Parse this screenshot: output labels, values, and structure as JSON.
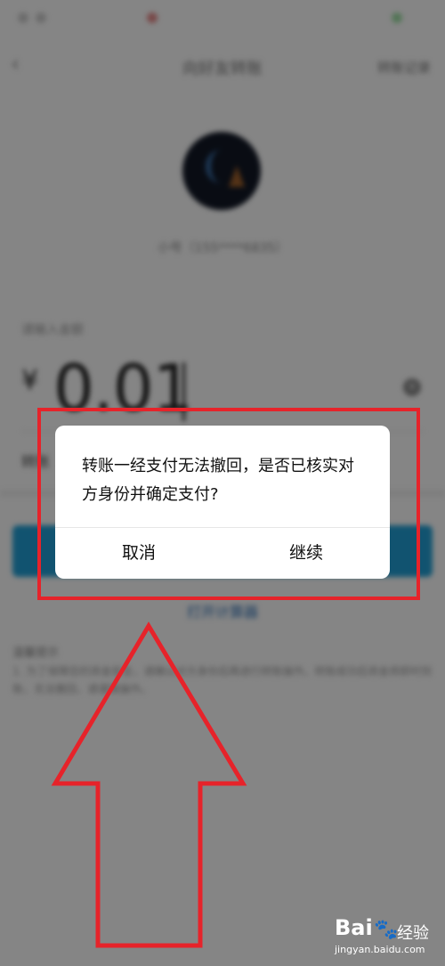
{
  "background_screen": {
    "status_icons": [
      "signal-icon",
      "wifi-icon",
      "battery-icon"
    ],
    "nav_back_icon": "chevron-left-icon",
    "nav_title": "向好友转账",
    "nav_right": "转账记录",
    "receiver_name": "小号（155****6835）",
    "amount_label": "请输入金额",
    "currency_symbol": "¥",
    "amount_value": "0.01",
    "note_label": "转账",
    "calculator_link": "打开计算器",
    "tips_title": "温馨提示",
    "tips_body": "1. 为了保障您的资金安全，请确认对方身份后再进行转账操作。转账成功后资金将即时到账，无法撤回，请谨慎操作。"
  },
  "dialog": {
    "message": "转账一经支付无法撤回，是否已核实对方身份并确定支付?",
    "cancel_label": "取消",
    "continue_label": "继续"
  },
  "annotation": {
    "highlight_color": "#e6232a",
    "arrow_color": "#e6232a"
  },
  "watermark": {
    "logo": "Bai",
    "logo_suffix": "经验",
    "url": "jingyan.baidu.com"
  },
  "colors": {
    "primary_button": "#21a0d6",
    "link": "#2b6fb5"
  }
}
